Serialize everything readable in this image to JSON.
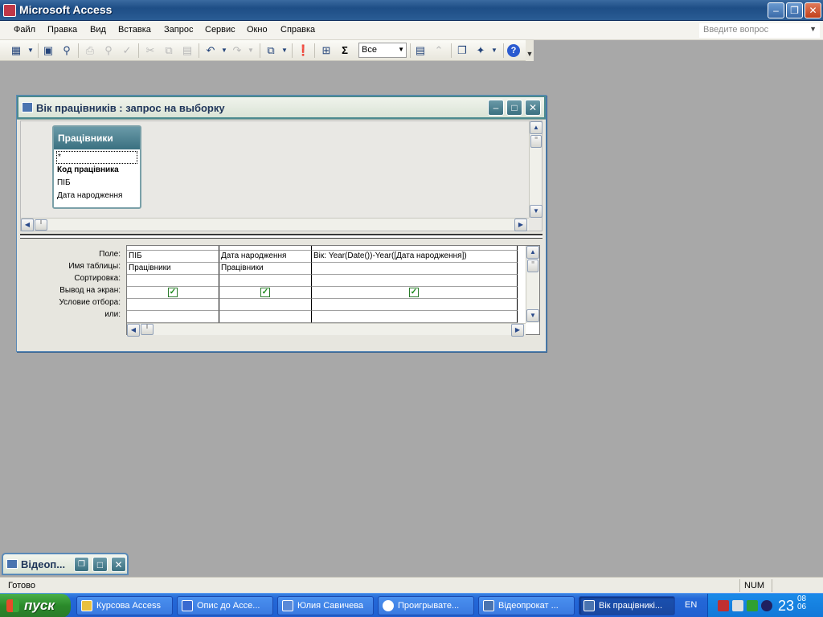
{
  "app": {
    "title": "Microsoft Access",
    "brand_color": "#c03848"
  },
  "menubar": {
    "items": [
      "Файл",
      "Правка",
      "Вид",
      "Вставка",
      "Запрос",
      "Сервис",
      "Окно",
      "Справка"
    ],
    "ask_placeholder": "Введите вопрос"
  },
  "toolbar": {
    "top_values_combo": "Все",
    "icons": [
      "view-icon",
      "save-icon",
      "search-file-icon",
      "print-icon",
      "print-preview-icon",
      "spelling-icon",
      "cut-icon",
      "copy-icon",
      "paste-icon",
      "undo-icon",
      "redo-icon",
      "query-type-icon",
      "run-icon",
      "show-table-icon",
      "totals-icon",
      "properties-icon",
      "build-icon",
      "database-window-icon",
      "new-object-icon",
      "help-icon"
    ]
  },
  "query_window": {
    "title": "Вік працівників : запрос на выборку",
    "field_list": {
      "title": "Працівники",
      "items": [
        "*",
        "Код працівника",
        "ПІБ",
        "Дата народження"
      ]
    },
    "row_labels": [
      "Поле:",
      "Имя таблицы:",
      "Сортировка:",
      "Вывод на экран:",
      "Условие отбора:",
      "или:"
    ],
    "columns": [
      {
        "field": "ПІБ",
        "table": "Працівники",
        "show": true
      },
      {
        "field": "Дата народження",
        "table": "Працівники",
        "show": true
      },
      {
        "field": "Вік: Year(Date())-Year([Дата народження])",
        "table": "",
        "show": true
      }
    ]
  },
  "minimized_window": {
    "title": "Відеоп..."
  },
  "statusbar": {
    "text": "Готово",
    "num": "NUM"
  },
  "taskbar": {
    "start_label": "пуск",
    "tasks": [
      {
        "label": "Курсова Access",
        "active": false,
        "icon_color": "#e8c040"
      },
      {
        "label": "Опис до Acce...",
        "active": false,
        "icon_color": "#3a6ad0"
      },
      {
        "label": "Юлия Савичева",
        "active": false,
        "icon_color": "#5a8ad8"
      },
      {
        "label": "Проигрывате...",
        "active": false,
        "icon_color": "#ffffff"
      },
      {
        "label": "Відеопрокат ...",
        "active": false,
        "icon_color": "#4a74b0"
      },
      {
        "label": "Вік працівникі...",
        "active": true,
        "icon_color": "#4a74b0"
      }
    ],
    "language": "EN",
    "clock_hour": "23",
    "clock_minute": "08",
    "clock_second": "06"
  }
}
